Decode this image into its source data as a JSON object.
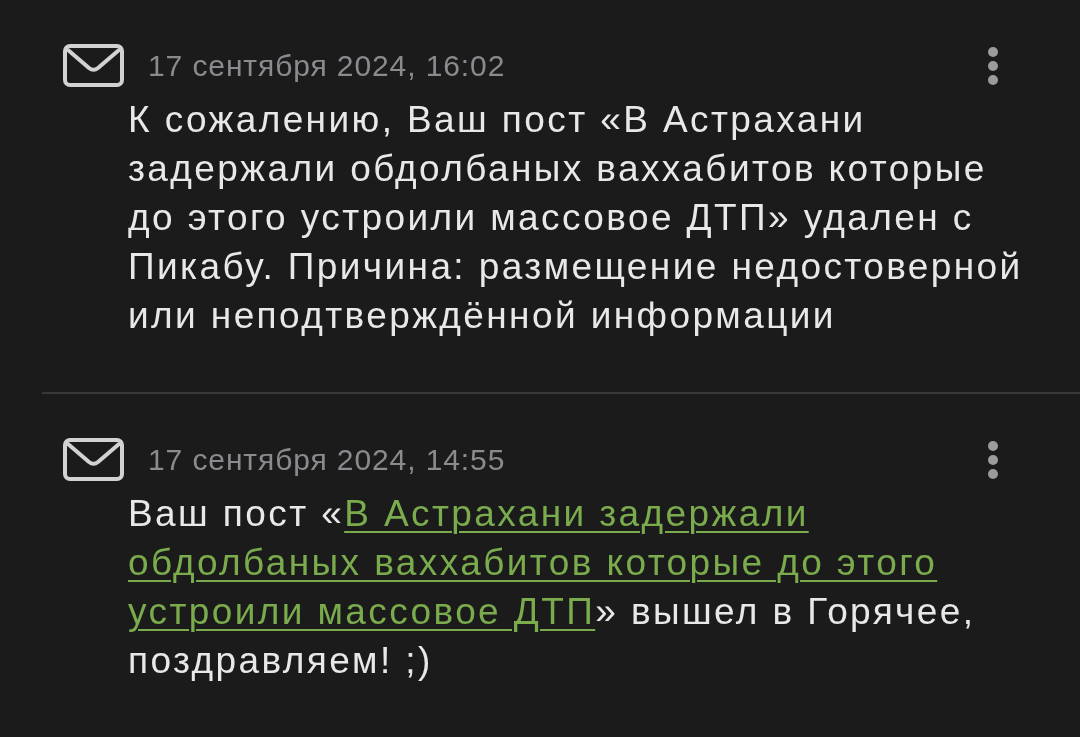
{
  "notifications": [
    {
      "date": "17 сентября 2024, 16:02",
      "parts": [
        {
          "kind": "text",
          "text": "К сожалению, Ваш пост «В Астрахани задержали обдолбаных ваххабитов которые до этого устроили массовое ДТП» удален с Пикабу. Причина: размещение недостоверной или неподтверждённой информации"
        }
      ]
    },
    {
      "date": "17 сентября 2024, 14:55",
      "parts": [
        {
          "kind": "text",
          "text": "Ваш пост «"
        },
        {
          "kind": "link",
          "text": "В Астрахани задержали обдолбаных ваххабитов которые до этого устроили массовое ДТП"
        },
        {
          "kind": "text",
          "text": "» вышел в Горячее, поздравляем! ;)"
        }
      ]
    }
  ]
}
